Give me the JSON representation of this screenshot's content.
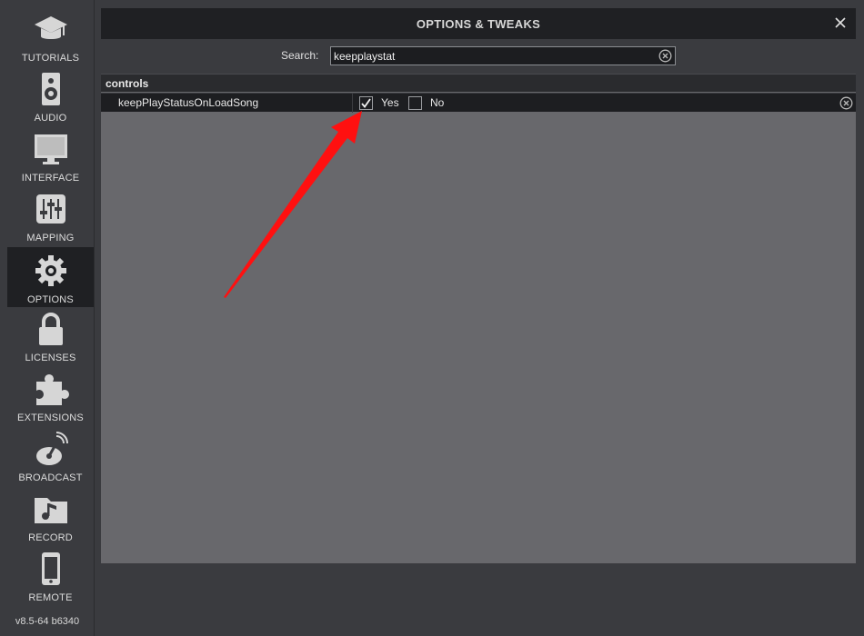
{
  "sidebar": {
    "items": [
      {
        "label": "TUTORIALS",
        "icon": "graduation-cap-icon"
      },
      {
        "label": "AUDIO",
        "icon": "speaker-icon"
      },
      {
        "label": "INTERFACE",
        "icon": "monitor-icon"
      },
      {
        "label": "MAPPING",
        "icon": "sliders-icon"
      },
      {
        "label": "OPTIONS",
        "icon": "gear-icon",
        "active": true
      },
      {
        "label": "LICENSES",
        "icon": "lock-icon"
      },
      {
        "label": "EXTENSIONS",
        "icon": "puzzle-icon"
      },
      {
        "label": "BROADCAST",
        "icon": "broadcast-icon"
      },
      {
        "label": "RECORD",
        "icon": "music-folder-icon"
      },
      {
        "label": "REMOTE",
        "icon": "phone-icon"
      }
    ],
    "version": "v8.5-64 b6340"
  },
  "window": {
    "title": "OPTIONS & TWEAKS"
  },
  "search": {
    "label": "Search:",
    "value": "keepplaystat"
  },
  "options": {
    "group": "controls",
    "rows": [
      {
        "name": "keepPlayStatusOnLoadSong",
        "yes_label": "Yes",
        "no_label": "No",
        "value": "Yes"
      }
    ]
  },
  "colors": {
    "accent_arrow": "#ff1010",
    "panel_bg": "#68686c",
    "header_bg": "#1f2023"
  }
}
